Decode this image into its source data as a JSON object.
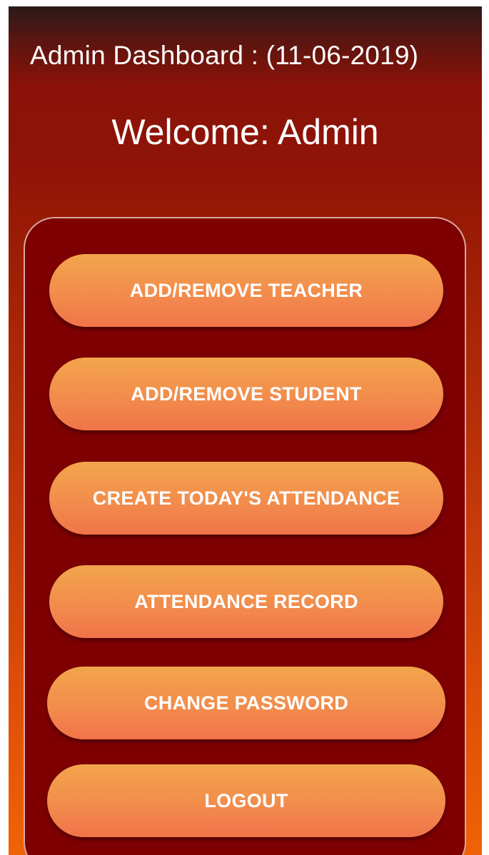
{
  "header": {
    "title": "Admin Dashboard : (11-06-2019)"
  },
  "welcome_text": "Welcome: Admin",
  "menu": {
    "add_remove_teacher": "ADD/REMOVE TEACHER",
    "add_remove_student": "ADD/REMOVE STUDENT",
    "create_attendance": "CREATE TODAY'S ATTENDANCE",
    "attendance_record": "ATTENDANCE RECORD",
    "change_password": "CHANGE PASSWORD",
    "logout": "LOGOUT"
  },
  "colors": {
    "panel": "#7e0003",
    "button_top": "#f2a54c",
    "button_bottom": "#f1744a",
    "background_top": "#2a1a18",
    "background_bottom": "#ef6306"
  }
}
